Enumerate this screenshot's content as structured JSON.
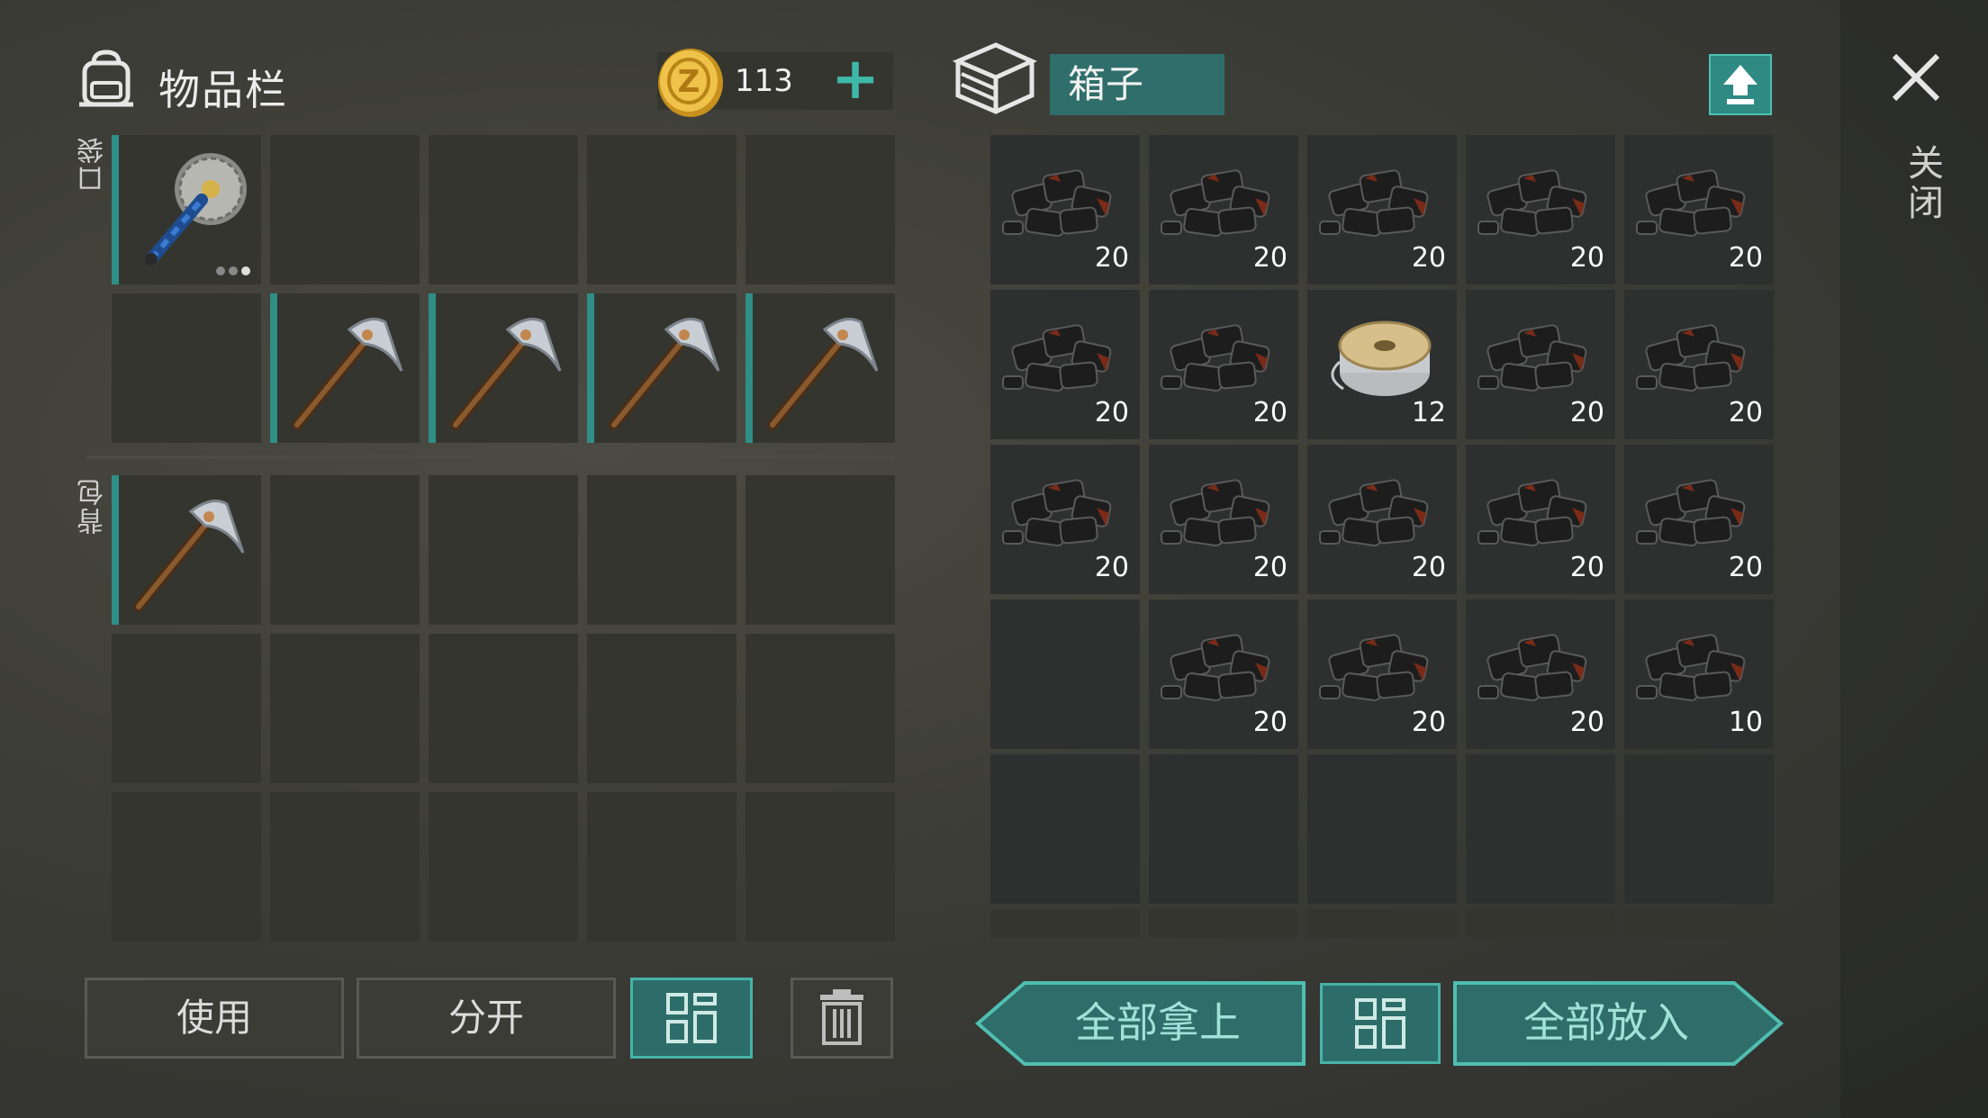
{
  "inventory": {
    "title": "物品栏",
    "coins": "113",
    "pocket_label": "口袋",
    "backpack_label": "背包",
    "use_label": "使用",
    "split_label": "分开"
  },
  "chest": {
    "name": "箱子",
    "close_label": "关闭",
    "take_all_label": "全部拿上",
    "put_all_label": "全部放入",
    "counts": [
      "20",
      "20",
      "20",
      "20",
      "20",
      "20",
      "20",
      "12",
      "20",
      "20",
      "20",
      "20",
      "20",
      "20",
      "20",
      "20",
      "20",
      "20",
      "10"
    ]
  },
  "colors": {
    "accent": "#2f8f86",
    "teal_button": "#2d6d69",
    "plus": "#3fb8a8",
    "coin": "#e2b23a"
  },
  "icons": [
    "backpack-icon",
    "coin-icon",
    "plus-icon",
    "chest-icon",
    "upload-icon",
    "close-icon",
    "grid-icon",
    "trash-icon",
    "saw-mace-icon",
    "pickaxe-icon",
    "charcoal-icon",
    "wire-spool-icon"
  ]
}
